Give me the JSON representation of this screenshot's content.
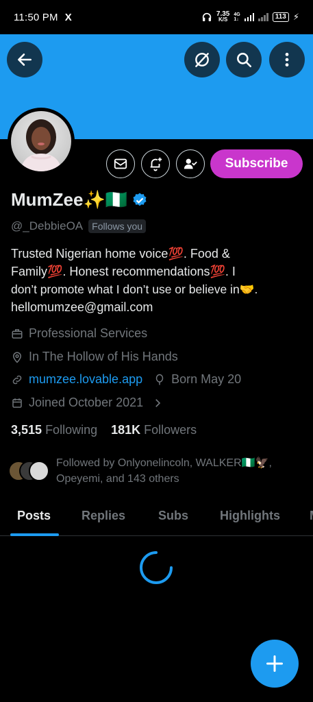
{
  "status_bar": {
    "time": "11:50 PM",
    "x_app_icon": "X",
    "net_speed_value": "7.35",
    "net_speed_unit": "K/S",
    "network": "4G",
    "network_sub": "1↓",
    "battery": "113",
    "icons": [
      "headphones-icon",
      "signal-icon",
      "signal-icon",
      "battery-icon",
      "charging-bolt-icon"
    ]
  },
  "header": {
    "banner_color": "#1d9bf0",
    "back_icon": "back-arrow-icon",
    "grok_icon": "grok-icon",
    "search_icon": "search-icon",
    "more_icon": "more-vertical-icon"
  },
  "profile": {
    "display_name": "MumZee✨🇳🇬",
    "handle": "@_DebbieOA",
    "follows_you": "Follows you",
    "subscribe_label": "Subscribe",
    "subscribe_color": "#c936cc",
    "bio_lines": [
      "Trusted Nigerian home voice💯.  Food &",
      "Family💯.  Honest recommendations💯.  I",
      "don’t promote what I don’t use or believe in🤝.",
      "hellomumzee@gmail.com"
    ],
    "category": "Professional Services",
    "location": "In The Hollow of His Hands",
    "website": "mumzee.lovable.app",
    "birthday": "Born May 20",
    "joined": "Joined October 2021",
    "following_count": "3,515",
    "following_label": "Following",
    "followers_count": "181K",
    "followers_label": "Followers",
    "followed_by_text": "Followed by Onlyonelincoln, WALKER🇳🇬🦅, Opeyemi, and 143 others"
  },
  "tabs": [
    {
      "label": "Posts",
      "active": true
    },
    {
      "label": "Replies",
      "active": false
    },
    {
      "label": "Subs",
      "active": false
    },
    {
      "label": "Highlights",
      "active": false
    },
    {
      "label": "M",
      "active": false
    }
  ],
  "accent_color": "#1d9bf0"
}
